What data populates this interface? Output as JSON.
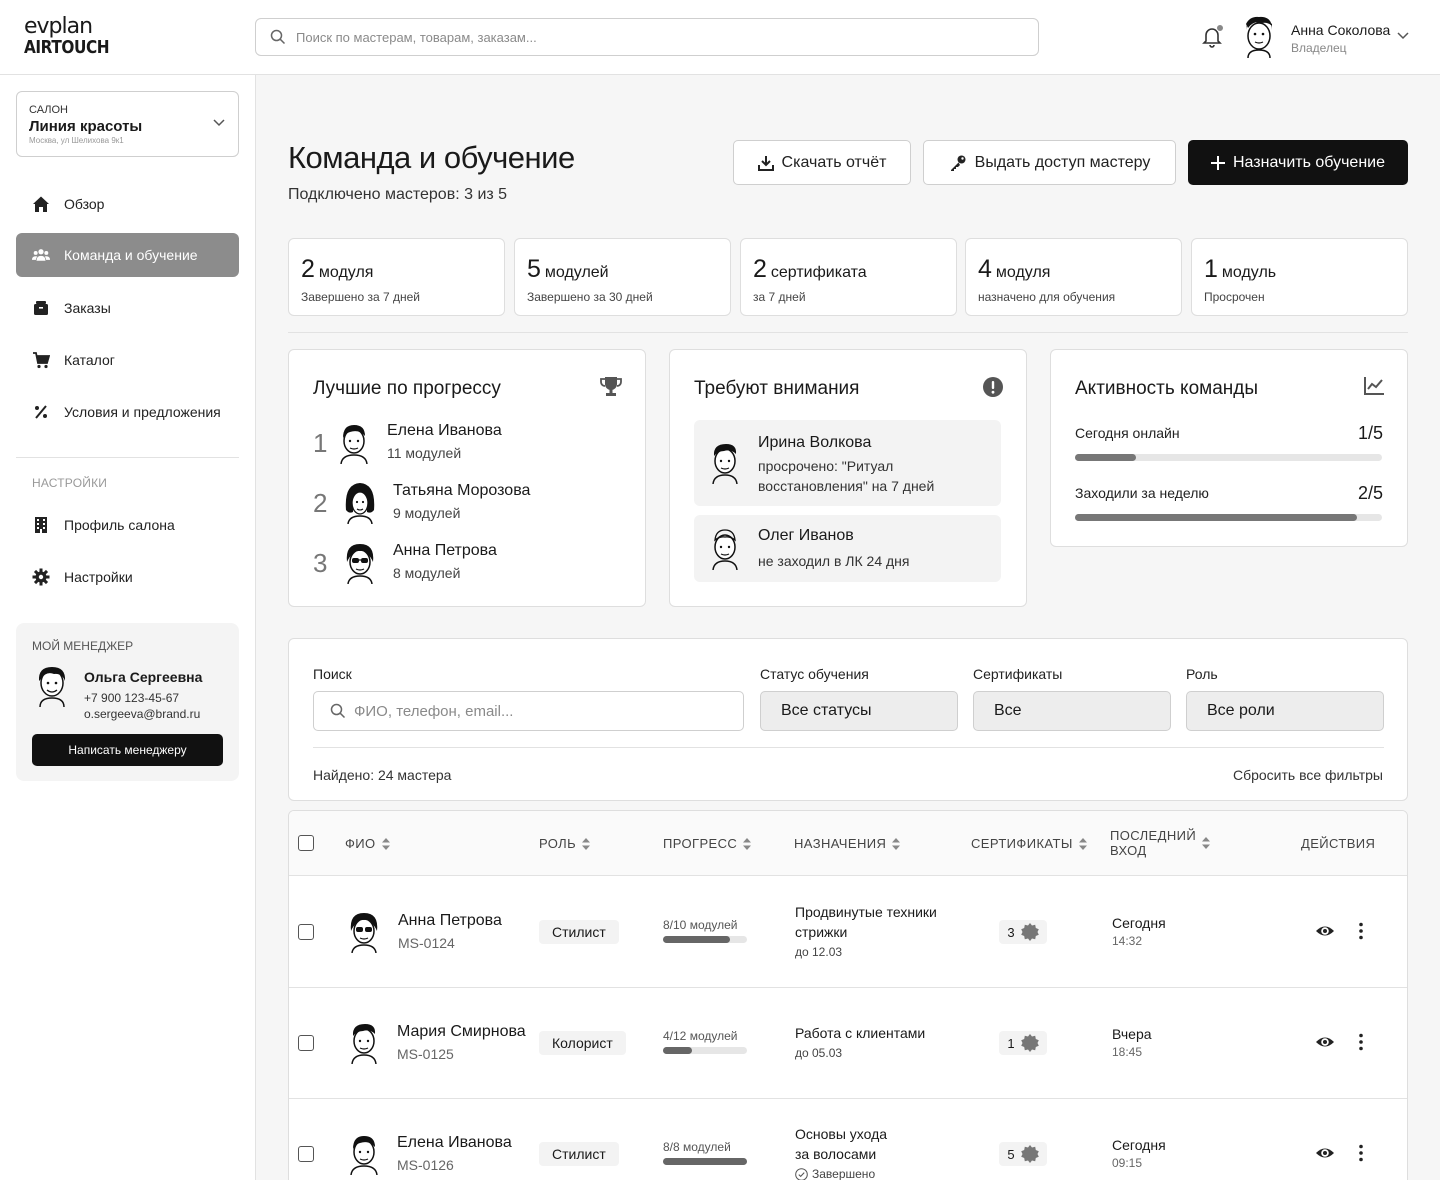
{
  "brand": {
    "line1": "evplan",
    "line2": "AIRTOUCH"
  },
  "search": {
    "placeholder": "Поиск по мастерам, товарам, заказам..."
  },
  "user": {
    "name": "Анна Соколова",
    "role": "Владелец"
  },
  "salon": {
    "label": "САЛОН",
    "name": "Линия красоты",
    "address": "Москва, ул Шелихова 9к1"
  },
  "nav": {
    "items": [
      {
        "label": "Обзор",
        "icon": "home-icon"
      },
      {
        "label": "Команда и обучение",
        "icon": "team-icon",
        "active": true
      },
      {
        "label": "Заказы",
        "icon": "box-icon"
      },
      {
        "label": "Каталог",
        "icon": "cart-icon"
      },
      {
        "label": "Условия и предложения",
        "icon": "percent-icon"
      }
    ],
    "section_label": "НАСТРОЙКИ",
    "settings_items": [
      {
        "label": "Профиль салона",
        "icon": "building-icon"
      },
      {
        "label": "Настройки",
        "icon": "gear-icon"
      }
    ]
  },
  "manager": {
    "label": "МОЙ МЕНЕДЖЕР",
    "name": "Ольга Сергеевна",
    "phone": "+7 900 123-45-67",
    "email": "o.sergeeva@brand.ru",
    "button": "Написать менеджеру"
  },
  "page": {
    "title": "Команда и обучение",
    "subtitle": "Подключено мастеров: 3 из 5",
    "buttons": {
      "download": "Скачать отчёт",
      "access": "Выдать доступ мастеру",
      "assign": "Назначить обучение"
    }
  },
  "stats": [
    {
      "value": "2",
      "unit": "модуля",
      "caption": "Завершено за 7 дней"
    },
    {
      "value": "5",
      "unit": "модулей",
      "caption": "Завершено за 30 дней"
    },
    {
      "value": "2",
      "unit": "сертификата",
      "caption": "за 7 дней"
    },
    {
      "value": "4",
      "unit": "модуля",
      "caption": "назначено для обучения"
    },
    {
      "value": "1",
      "unit": "модуль",
      "caption": "Просрочен"
    }
  ],
  "leaders": {
    "title": "Лучшие по прогрессу",
    "rows": [
      {
        "rank": "1",
        "name": "Елена Иванова",
        "modules": "11 модулей"
      },
      {
        "rank": "2",
        "name": "Татьяна Морозова",
        "modules": "9 модулей"
      },
      {
        "rank": "3",
        "name": "Анна Петрова",
        "modules": "8 модулей"
      }
    ]
  },
  "attention": {
    "title": "Требуют внимания",
    "items": [
      {
        "name": "Ирина Волкова",
        "desc": "просрочено: \"Ритуал восстановления\" на 7 дней"
      },
      {
        "name": "Олег Иванов",
        "desc": "не заходил в ЛК 24 дня"
      }
    ]
  },
  "activity": {
    "title": "Активность команды",
    "rows": [
      {
        "label": "Сегодня онлайн",
        "value": "1/5",
        "fraction": 0.2
      },
      {
        "label": "Заходили за неделю",
        "value": "2/5",
        "fraction": 0.92
      }
    ]
  },
  "filters": {
    "search_label": "Поиск",
    "search_placeholder": "ФИО, телефон, email...",
    "status_label": "Статус обучения",
    "status_value": "Все статусы",
    "cert_label": "Сертификаты",
    "cert_value": "Все",
    "role_label": "Роль",
    "role_value": "Все роли",
    "found": "Найдено: 24 мастера",
    "reset": "Сбросить все фильтры"
  },
  "table": {
    "headers": {
      "name": "ФИО",
      "role": "РОЛЬ",
      "progress": "ПРОГРЕСС",
      "assignments": "НАЗНАЧЕНИЯ",
      "certs": "СЕРТИФИКАТЫ",
      "last_login_1": "ПОСЛЕДНИЙ",
      "last_login_2": "ВХОД",
      "actions": "ДЕЙСТВИЯ"
    },
    "rows": [
      {
        "name": "Анна Петрова",
        "id": "MS-0124",
        "role": "Стилист",
        "progress_text": "8/10 модулей",
        "progress": 0.8,
        "assign1": "Продвинутые техники",
        "assign2": "стрижки",
        "due": "до 12.03",
        "certs": "3",
        "last": "Сегодня",
        "time": "14:32"
      },
      {
        "name": "Мария Смирнова",
        "id": "MS-0125",
        "role": "Колорист",
        "progress_text": "4/12 модулей",
        "progress": 0.34,
        "assign1": "Работа с клиентами",
        "assign2": "",
        "due": "до 05.03",
        "certs": "1",
        "last": "Вчера",
        "time": "18:45"
      },
      {
        "name": "Елена Иванова",
        "id": "MS-0126",
        "role": "Стилист",
        "progress_text": "8/8 модулей",
        "progress": 1.0,
        "assign1": "Основы ухода",
        "assign2": "за волосами",
        "due": "Завершено",
        "certs": "5",
        "last": "Сегодня",
        "time": "09:15"
      }
    ]
  }
}
